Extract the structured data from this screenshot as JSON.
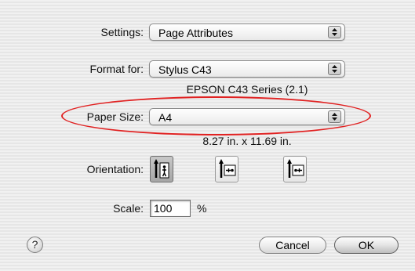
{
  "settings": {
    "label": "Settings:",
    "value": "Page Attributes"
  },
  "format_for": {
    "label": "Format for:",
    "value": "Stylus C43",
    "printer_note": "EPSON C43 Series (2.1)"
  },
  "paper_size": {
    "label": "Paper Size:",
    "value": "A4",
    "dimensions": "8.27 in. x 11.69 in."
  },
  "orientation": {
    "label": "Orientation:",
    "options": [
      {
        "icon": "portrait-orientation-icon",
        "selected": true
      },
      {
        "icon": "landscape-left-orientation-icon",
        "selected": false
      },
      {
        "icon": "landscape-right-orientation-icon",
        "selected": false
      }
    ]
  },
  "scale": {
    "label": "Scale:",
    "value": "100",
    "unit": "%"
  },
  "buttons": {
    "help": "?",
    "cancel": "Cancel",
    "ok": "OK"
  },
  "colors": {
    "annotation": "#e12222",
    "background": "#ececec"
  }
}
